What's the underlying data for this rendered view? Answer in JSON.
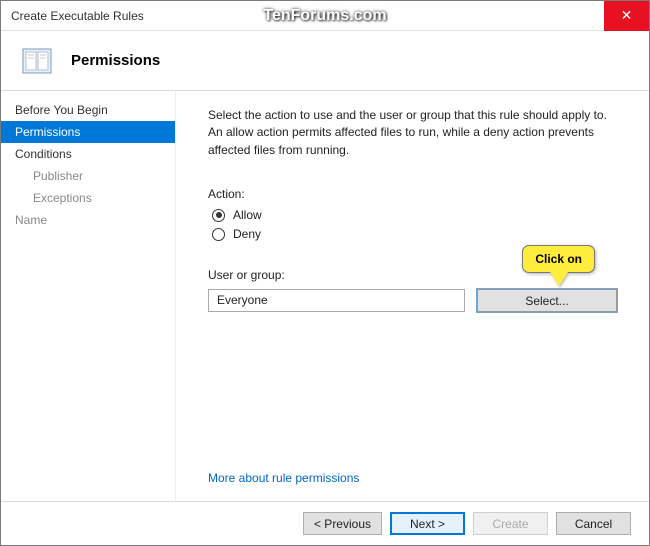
{
  "window": {
    "title": "Create Executable Rules",
    "watermark": "TenForums.com"
  },
  "header": {
    "title": "Permissions"
  },
  "sidebar": {
    "items": [
      {
        "label": "Before You Begin",
        "type": "top"
      },
      {
        "label": "Permissions",
        "type": "selected"
      },
      {
        "label": "Conditions",
        "type": "top"
      },
      {
        "label": "Publisher",
        "type": "sub"
      },
      {
        "label": "Exceptions",
        "type": "sub"
      },
      {
        "label": "Name",
        "type": "topdim"
      }
    ]
  },
  "content": {
    "description": "Select the action to use and the user or group that this rule should apply to. An allow action permits affected files to run, while a deny action prevents affected files from running.",
    "action_label": "Action:",
    "radio_allow": "Allow",
    "radio_deny": "Deny",
    "selected_action": "Allow",
    "user_group_label": "User or group:",
    "user_group_value": "Everyone",
    "select_button": "Select...",
    "callout": "Click on",
    "more_link": "More about rule permissions"
  },
  "footer": {
    "previous": "< Previous",
    "next": "Next >",
    "create": "Create",
    "cancel": "Cancel"
  }
}
